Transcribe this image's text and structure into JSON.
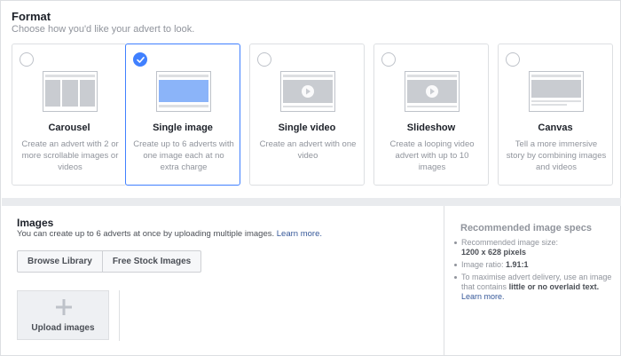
{
  "format": {
    "title": "Format",
    "subtitle": "Choose how you'd like your advert to look.",
    "options": [
      {
        "name": "Carousel",
        "description": "Create an advert with 2 or more scrollable images or videos",
        "selected": false,
        "thumb": "carousel"
      },
      {
        "name": "Single image",
        "description": "Create up to 6 adverts with one image each at no extra charge",
        "selected": true,
        "thumb": "single-image"
      },
      {
        "name": "Single video",
        "description": "Create an advert with one video",
        "selected": false,
        "thumb": "video"
      },
      {
        "name": "Slideshow",
        "description": "Create a looping video advert with up to 10 images",
        "selected": false,
        "thumb": "video"
      },
      {
        "name": "Canvas",
        "description": "Tell a more immersive story by combining images and videos",
        "selected": false,
        "thumb": "canvas"
      }
    ]
  },
  "images": {
    "title": "Images",
    "subtitle": "You can create up to 6 adverts at once by uploading multiple images.",
    "learn_more": "Learn more.",
    "browse_library": "Browse Library",
    "free_stock": "Free Stock Images",
    "upload_label": "Upload images"
  },
  "specs": {
    "title": "Recommended image specs",
    "size_label": "Recommended image size:",
    "size_value": "1200 x 628 pixels",
    "ratio_label": "Image ratio:",
    "ratio_value": "1.91:1",
    "tip_prefix": "To maximise advert delivery, use an image that contains",
    "tip_bold": "little or no overlaid text.",
    "tip_link": "Learn more."
  },
  "colors": {
    "accent": "#4080ff",
    "link": "#365899",
    "muted": "#90949c"
  }
}
